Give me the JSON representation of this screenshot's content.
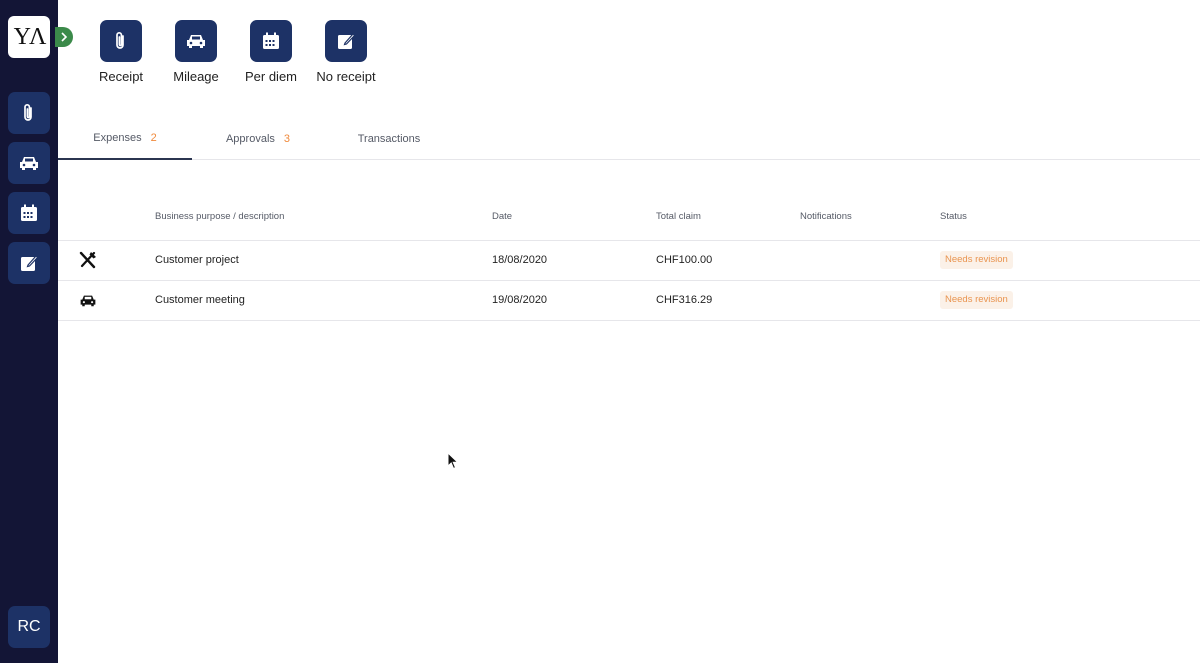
{
  "brand": {
    "logo_text": "YΛ",
    "accent": "#1d3266",
    "sidebar_bg": "#131536"
  },
  "sidebar": {
    "items": [
      {
        "name": "receipt",
        "icon": "paperclip-icon"
      },
      {
        "name": "mileage",
        "icon": "car-icon"
      },
      {
        "name": "per-diem",
        "icon": "calendar-icon"
      },
      {
        "name": "no-receipt",
        "icon": "edit-icon"
      }
    ],
    "avatar_initials": "RC"
  },
  "actions": [
    {
      "label": "Receipt",
      "icon": "paperclip-icon"
    },
    {
      "label": "Mileage",
      "icon": "car-icon"
    },
    {
      "label": "Per diem",
      "icon": "calendar-icon"
    },
    {
      "label": "No receipt",
      "icon": "edit-icon"
    }
  ],
  "tabs": [
    {
      "label": "Expenses",
      "count": "2",
      "active": true
    },
    {
      "label": "Approvals",
      "count": "3",
      "active": false
    },
    {
      "label": "Transactions",
      "count": "",
      "active": false
    }
  ],
  "table": {
    "columns": [
      "Business purpose / description",
      "Date",
      "Total claim",
      "Notifications",
      "Status"
    ],
    "rows": [
      {
        "icon": "restaurant-icon",
        "description": "Customer project",
        "date": "18/08/2020",
        "total": "CHF100.00",
        "notifications": "",
        "status": "Needs revision"
      },
      {
        "icon": "car-icon",
        "description": "Customer meeting",
        "date": "19/08/2020",
        "total": "CHF316.29",
        "notifications": "",
        "status": "Needs revision"
      }
    ]
  }
}
